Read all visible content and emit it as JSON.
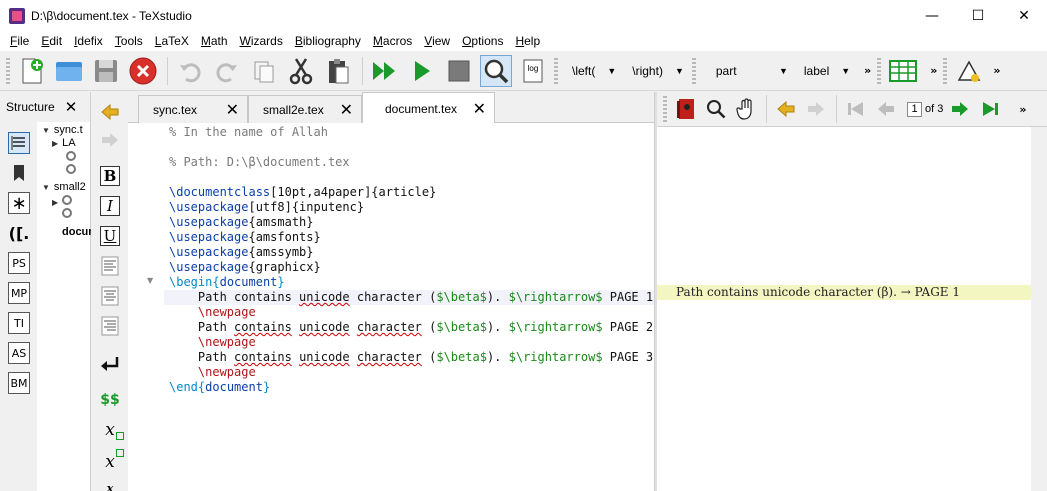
{
  "window": {
    "title": "D:\\β\\document.tex - TeXstudio",
    "minimize": "—",
    "maximize": "☐",
    "close": "✕"
  },
  "menu": [
    "File",
    "Edit",
    "Idefix",
    "Tools",
    "LaTeX",
    "Math",
    "Wizards",
    "Bibliography",
    "Macros",
    "View",
    "Options",
    "Help"
  ],
  "toolbar": {
    "left_combo": "\\left(",
    "right_combo": "\\right)",
    "part_combo": "part",
    "label_combo": "label",
    "more": "»",
    "log_label": "log"
  },
  "structure": {
    "title": "Structure",
    "close": "✕",
    "icons": [
      "PS",
      "MP",
      "TI",
      "AS",
      "BM"
    ],
    "tree": [
      {
        "text": "sync.t",
        "indent": 0,
        "expanded": true
      },
      {
        "text": "LA",
        "indent": 1,
        "expanded": false
      },
      {
        "text": "small2",
        "indent": 0,
        "expanded": true
      },
      {
        "text": "docum",
        "indent": 0,
        "bold": true
      }
    ]
  },
  "formatting": {
    "bold": "B",
    "italic": "I",
    "underline": "U",
    "math": "$$",
    "sub": "x",
    "sup": "x",
    "frac": "x"
  },
  "tabs": [
    {
      "label": "sync.tex",
      "active": false
    },
    {
      "label": "small2e.tex",
      "active": false
    },
    {
      "label": "document.tex",
      "active": true
    }
  ],
  "code": [
    {
      "segments": [
        {
          "t": "% In the name of Allah",
          "c": "comment"
        }
      ]
    },
    {
      "segments": []
    },
    {
      "segments": [
        {
          "t": "% Path: D:\\β\\document.tex",
          "c": "comment"
        }
      ]
    },
    {
      "segments": []
    },
    {
      "segments": [
        {
          "t": "\\documentclass",
          "c": "cmd"
        },
        {
          "t": "[10pt,a4paper]{article}",
          "c": "text"
        }
      ]
    },
    {
      "segments": [
        {
          "t": "\\usepackage",
          "c": "cmd"
        },
        {
          "t": "[utf8]{inputenc}",
          "c": "text"
        }
      ]
    },
    {
      "segments": [
        {
          "t": "\\usepackage",
          "c": "cmd"
        },
        {
          "t": "{amsmath}",
          "c": "text"
        }
      ]
    },
    {
      "segments": [
        {
          "t": "\\usepackage",
          "c": "cmd"
        },
        {
          "t": "{amsfonts}",
          "c": "text"
        }
      ]
    },
    {
      "segments": [
        {
          "t": "\\usepackage",
          "c": "cmd"
        },
        {
          "t": "{amssymb}",
          "c": "text"
        }
      ]
    },
    {
      "segments": [
        {
          "t": "\\usepackage",
          "c": "cmd"
        },
        {
          "t": "{graphicx}",
          "c": "text"
        }
      ]
    },
    {
      "segments": [
        {
          "t": "\\begin",
          "c": "cyan"
        },
        {
          "t": "{",
          "c": "cyan"
        },
        {
          "t": "document",
          "c": "cmd"
        },
        {
          "t": "}",
          "c": "cyan"
        }
      ]
    },
    {
      "highlight": true,
      "segments": [
        {
          "t": "    Path contains ",
          "c": "text"
        },
        {
          "t": "unicode",
          "c": "text",
          "squig": true
        },
        {
          "t": " character (",
          "c": "text"
        },
        {
          "t": "$\\beta$",
          "c": "green"
        },
        {
          "t": "). ",
          "c": "text"
        },
        {
          "t": "$\\rightarrow$",
          "c": "green"
        },
        {
          "t": " PAGE 1",
          "c": "text"
        }
      ]
    },
    {
      "segments": [
        {
          "t": "    \\newpage",
          "c": "red"
        }
      ]
    },
    {
      "segments": [
        {
          "t": "    Path ",
          "c": "text"
        },
        {
          "t": "contains",
          "c": "text",
          "squig": true
        },
        {
          "t": " ",
          "c": "text"
        },
        {
          "t": "unicode",
          "c": "text",
          "squig": true
        },
        {
          "t": " ",
          "c": "text"
        },
        {
          "t": "character",
          "c": "text",
          "squig": true
        },
        {
          "t": " (",
          "c": "text"
        },
        {
          "t": "$\\beta$",
          "c": "green"
        },
        {
          "t": "). ",
          "c": "text"
        },
        {
          "t": "$\\rightarrow$",
          "c": "green"
        },
        {
          "t": " PAGE 2",
          "c": "text"
        }
      ]
    },
    {
      "segments": [
        {
          "t": "    \\newpage",
          "c": "red"
        }
      ]
    },
    {
      "segments": [
        {
          "t": "    Path ",
          "c": "text"
        },
        {
          "t": "contains",
          "c": "text",
          "squig": true
        },
        {
          "t": " ",
          "c": "text"
        },
        {
          "t": "unicode",
          "c": "text",
          "squig": true
        },
        {
          "t": " ",
          "c": "text"
        },
        {
          "t": "character",
          "c": "text",
          "squig": true
        },
        {
          "t": " (",
          "c": "text"
        },
        {
          "t": "$\\beta$",
          "c": "green"
        },
        {
          "t": "). ",
          "c": "text"
        },
        {
          "t": "$\\rightarrow$",
          "c": "green"
        },
        {
          "t": " PAGE 3",
          "c": "text"
        }
      ]
    },
    {
      "segments": [
        {
          "t": "    \\newpage",
          "c": "red"
        }
      ]
    },
    {
      "segments": [
        {
          "t": "\\end",
          "c": "cyan"
        },
        {
          "t": "{",
          "c": "cyan"
        },
        {
          "t": "document",
          "c": "cmd"
        },
        {
          "t": "}",
          "c": "cyan"
        }
      ]
    }
  ],
  "pdf": {
    "page_current": "1",
    "page_of": "of 3",
    "preview_text": "Path contains unicode character (β). → PAGE 1",
    "more": "»"
  },
  "colors": {
    "accent_blue": "#1f6fd1",
    "green_run": "#1a9a2a",
    "red_stop": "#d8302a",
    "gold_arrow": "#e2b020"
  }
}
